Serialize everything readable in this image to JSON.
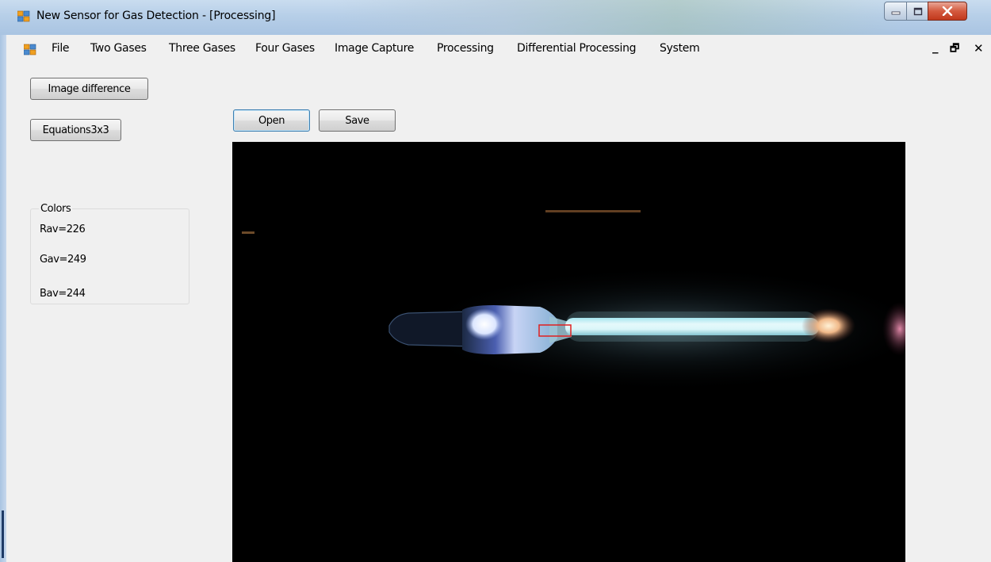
{
  "window": {
    "title": "New Sensor for Gas Detection - [Processing]",
    "app_icon": "app-window-icon",
    "caption_buttons": [
      "minimize-icon",
      "maximize-icon",
      "close-icon"
    ]
  },
  "menu": {
    "items": [
      "File",
      "Two Gases",
      "Three Gases",
      "Four Gases",
      "Image Capture",
      "Processing",
      "Differential Processing",
      "System"
    ],
    "mdi_controls": [
      "_",
      "🗗",
      "✕"
    ]
  },
  "sidebar": {
    "image_difference_label": "Image difference",
    "equations_label": "Equations3x3"
  },
  "toolbar": {
    "open_label": "Open",
    "save_label": "Save"
  },
  "colors_group": {
    "title": "Colors",
    "rav": "Rav=226",
    "gav": "Gav=249",
    "bav": "Bav=244"
  },
  "theme": {
    "title_bar": "#b7cfe8",
    "close_red": "#c1381c",
    "background": "#f0f0f0",
    "image_background": "#000000",
    "roi_rectangle": "#e02020"
  }
}
